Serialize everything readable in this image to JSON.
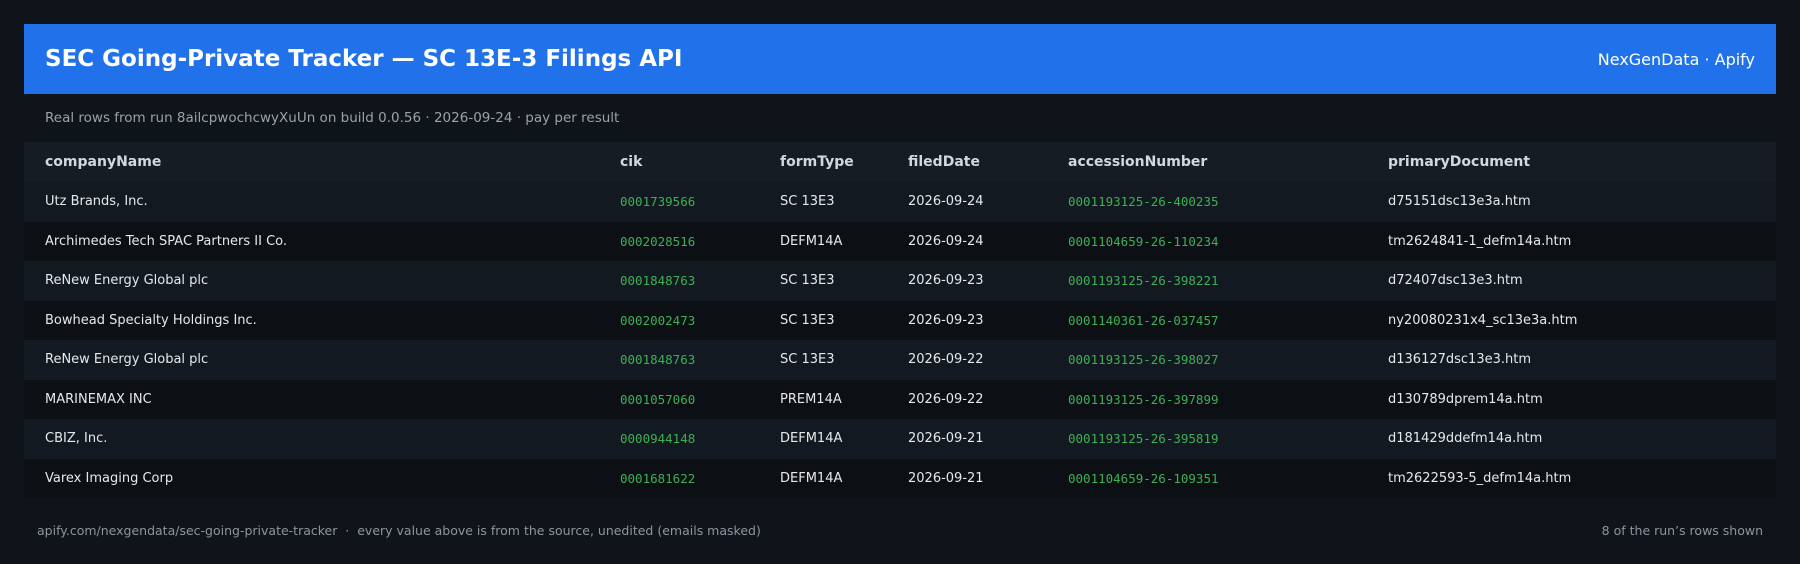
{
  "header": {
    "title": "SEC Going-Private Tracker — SC 13E-3 Filings API",
    "brand": "NexGenData · Apify"
  },
  "subtitle": "Real rows from run 8ailcpwochcwyXuUn on build 0.0.56 · 2026-09-24 · pay per result",
  "table": {
    "columns": [
      "companyName",
      "cik",
      "formType",
      "filedDate",
      "accessionNumber",
      "primaryDocument"
    ],
    "rows": [
      [
        "Utz Brands, Inc.",
        "0001739566",
        "SC 13E3",
        "2026-09-24",
        "0001193125-26-400235",
        "d75151dsc13e3a.htm"
      ],
      [
        "Archimedes Tech SPAC Partners II Co.",
        "0002028516",
        "DEFM14A",
        "2026-09-24",
        "0001104659-26-110234",
        "tm2624841-1_defm14a.htm"
      ],
      [
        "ReNew Energy Global plc",
        "0001848763",
        "SC 13E3",
        "2026-09-23",
        "0001193125-26-398221",
        "d72407dsc13e3.htm"
      ],
      [
        "Bowhead Specialty Holdings Inc.",
        "0002002473",
        "SC 13E3",
        "2026-09-23",
        "0001140361-26-037457",
        "ny20080231x4_sc13e3a.htm"
      ],
      [
        "ReNew Energy Global plc",
        "0001848763",
        "SC 13E3",
        "2026-09-22",
        "0001193125-26-398027",
        "d136127dsc13e3.htm"
      ],
      [
        "MARINEMAX INC",
        "0001057060",
        "PREM14A",
        "2026-09-22",
        "0001193125-26-397899",
        "d130789dprem14a.htm"
      ],
      [
        "CBIZ, Inc.",
        "0000944148",
        "DEFM14A",
        "2026-09-21",
        "0001193125-26-395819",
        "d181429ddefm14a.htm"
      ],
      [
        "Varex Imaging Corp",
        "0001681622",
        "DEFM14A",
        "2026-09-21",
        "0001104659-26-109351",
        "tm2622593-5_defm14a.htm"
      ]
    ]
  },
  "footer": {
    "left": "apify.com/nexgendata/sec-going-private-tracker  ·  every value above is from the source, unedited (emails masked)",
    "right": "8 of the run’s rows shown"
  },
  "colors": {
    "accent": "#2172ea",
    "id_text": "#3fae55",
    "background": "#0f141b"
  }
}
